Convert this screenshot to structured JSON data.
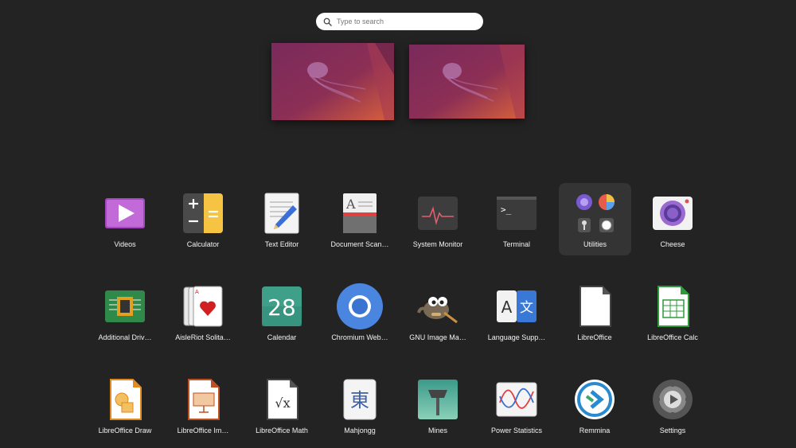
{
  "search": {
    "placeholder": "Type to search"
  },
  "apps": [
    {
      "label": "Videos",
      "icon": "videos-icon"
    },
    {
      "label": "Calculator",
      "icon": "calculator-icon"
    },
    {
      "label": "Text Editor",
      "icon": "text-editor-icon"
    },
    {
      "label": "Document Scan…",
      "icon": "document-scanner-icon"
    },
    {
      "label": "System Monitor",
      "icon": "system-monitor-icon"
    },
    {
      "label": "Terminal",
      "icon": "terminal-icon"
    },
    {
      "label": "Utilities",
      "icon": "utilities-folder-icon"
    },
    {
      "label": "Cheese",
      "icon": "cheese-icon"
    },
    {
      "label": "Additional Driv…",
      "icon": "additional-drivers-icon"
    },
    {
      "label": "AisleRiot Solita…",
      "icon": "aisleriot-solitaire-icon"
    },
    {
      "label": "Calendar",
      "icon": "calendar-icon",
      "day": "28"
    },
    {
      "label": "Chromium Web…",
      "icon": "chromium-icon"
    },
    {
      "label": "GNU Image Ma…",
      "icon": "gimp-icon"
    },
    {
      "label": "Language Supp…",
      "icon": "language-support-icon",
      "glyphs": [
        "A",
        "文"
      ]
    },
    {
      "label": "LibreOffice",
      "icon": "libreoffice-icon"
    },
    {
      "label": "LibreOffice Calc",
      "icon": "libreoffice-calc-icon"
    },
    {
      "label": "LibreOffice Draw",
      "icon": "libreoffice-draw-icon"
    },
    {
      "label": "LibreOffice Im…",
      "icon": "libreoffice-impress-icon"
    },
    {
      "label": "LibreOffice Math",
      "icon": "libreoffice-math-icon",
      "glyph": "√x"
    },
    {
      "label": "Mahjongg",
      "icon": "mahjongg-icon",
      "glyph": "東"
    },
    {
      "label": "Mines",
      "icon": "mines-icon"
    },
    {
      "label": "Power Statistics",
      "icon": "power-statistics-icon"
    },
    {
      "label": "Remmina",
      "icon": "remmina-icon"
    },
    {
      "label": "Settings",
      "icon": "settings-icon"
    }
  ],
  "colors": {
    "background": "#232323",
    "selected": "#343434",
    "accent": "#772953"
  }
}
